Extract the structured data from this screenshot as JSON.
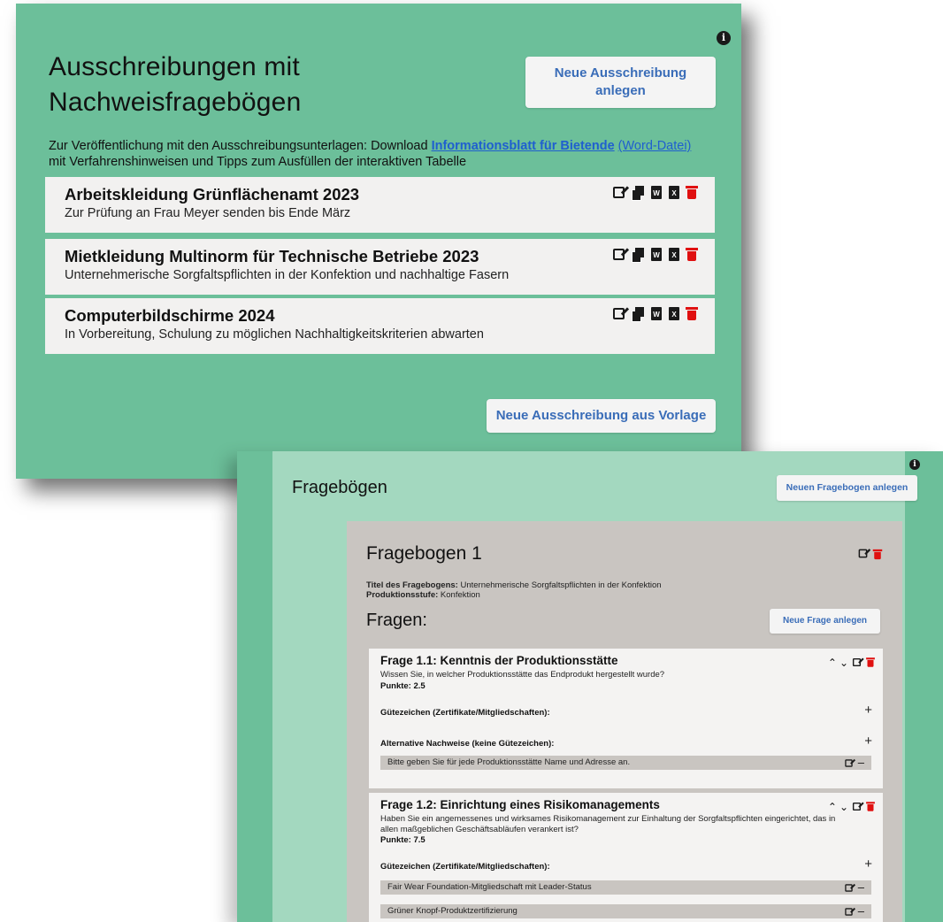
{
  "panel1": {
    "title": "Ausschreibungen mit Nachweisfragebögen",
    "new_button": "Neue Ausschreibung anlegen",
    "description_pre": "Zur Veröffentlichung mit den Ausschreibungsunterlagen: Download ",
    "description_link": "Informationsblatt für Bietende",
    "description_word": "(Word-Datei)",
    "description_post": "mit Verfahrenshinweisen und Tipps zum Ausfüllen der interaktiven Tabelle",
    "tenders": [
      {
        "title": "Arbeitskleidung Grünflächenamt 2023",
        "subtitle": "Zur Prüfung an Frau Meyer senden bis Ende März"
      },
      {
        "title": "Mietkleidung Multinorm für Technische Betriebe 2023",
        "subtitle": "Unternehmerische Sorgfaltspflichten in der Konfektion und nachhaltige Fasern"
      },
      {
        "title": "Computerbildschirme 2024",
        "subtitle": "In Vorbereitung, Schulung zu möglichen Nachhaltigkeitskriterien abwarten"
      }
    ],
    "template_button": "Neue Ausschreibung aus Vorlage",
    "icon_labels": {
      "word": "W",
      "excel": "X"
    }
  },
  "panel2": {
    "title": "Fragebögen",
    "new_button": "Neuen Fragebogen anlegen",
    "questionnaire": {
      "title": "Fragebogen 1",
      "meta_title_label": "Titel des Fragebogens:",
      "meta_title_value": " Unternehmerische Sorgfaltspflichten in der Konfektion",
      "meta_stage_label": "Produktionsstufe:",
      "meta_stage_value": " Konfektion",
      "questions_heading": "Fragen:",
      "new_question_button": "Neue Frage anlegen",
      "questions": [
        {
          "title": "Frage 1.1: Kenntnis der Produktionsstätte",
          "text": "Wissen Sie, in welcher Produktionsstätte das Endprodukt hergestellt wurde?",
          "points": "Punkte: 2.5",
          "labels_heading": "Gütezeichen (Zertifikate/Mitgliedschaften):",
          "alt_heading": "Alternative Nachweise (keine Gütezeichen):",
          "alt_items": [
            "Bitte geben Sie für jede Produktionsstätte Name und Adresse an."
          ]
        },
        {
          "title": "Frage 1.2: Einrichtung eines Risikomanagements",
          "text": "Haben Sie ein angemessenes und wirksames Risikomanagement zur Einhaltung der Sorgfaltspflichten eingerichtet, das in allen maßgeblichen Geschäftsabläufen verankert ist?",
          "points": "Punkte: 7.5",
          "labels_heading": "Gütezeichen (Zertifikate/Mitgliedschaften):",
          "label_items": [
            "Fair Wear Foundation-Mitgliedschaft mit Leader-Status",
            "Grüner Knopf-Produktzertifizierung"
          ]
        }
      ]
    }
  },
  "colors": {
    "panel_green": "#6cbf9a",
    "inner_green": "#a3d8bf",
    "card_gray": "#c9c5c1",
    "link_blue": "#1f5fcf",
    "button_text": "#3a6db8",
    "delete_red": "#e01010"
  }
}
